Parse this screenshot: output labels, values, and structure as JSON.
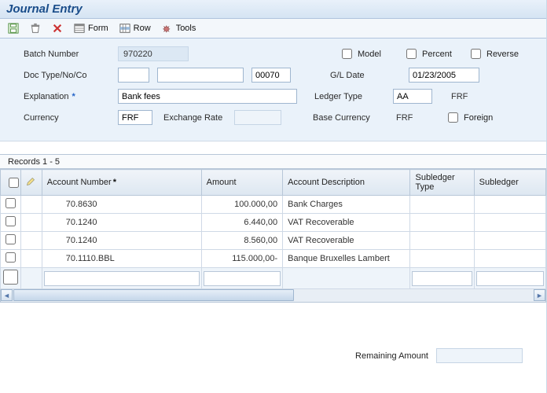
{
  "title": "Journal Entry",
  "toolbar": {
    "form": "Form",
    "row": "Row",
    "tools": "Tools"
  },
  "header": {
    "batch_number_label": "Batch Number",
    "batch_number": "970220",
    "model_label": "Model",
    "percent_label": "Percent",
    "reverse_label": "Reverse",
    "doc_label": "Doc Type/No/Co",
    "doc_type": "",
    "doc_no": "",
    "doc_co": "00070",
    "gl_date_label": "G/L Date",
    "gl_date": "01/23/2005",
    "explanation_label": "Explanation",
    "explanation": "Bank fees",
    "ledger_type_label": "Ledger Type",
    "ledger_type": "AA",
    "ledger_type_disp": "FRF",
    "currency_label": "Currency",
    "currency": "FRF",
    "exchange_rate_label": "Exchange Rate",
    "exchange_rate": "",
    "base_currency_label": "Base Currency",
    "base_currency": "FRF",
    "foreign_label": "Foreign"
  },
  "grid": {
    "records_label": "Records 1 - 5",
    "columns": {
      "account_number": "Account Number",
      "amount": "Amount",
      "account_description": "Account\nDescription",
      "subledger_type": "Subledger\nType",
      "subledger": "Subledger"
    },
    "rows": [
      {
        "account": "70.8630",
        "amount": "100.000,00",
        "desc": "Bank Charges",
        "sub_type": "",
        "sub": ""
      },
      {
        "account": "70.1240",
        "amount": "6.440,00",
        "desc": "VAT Recoverable",
        "sub_type": "",
        "sub": ""
      },
      {
        "account": "70.1240",
        "amount": "8.560,00",
        "desc": "VAT Recoverable",
        "sub_type": "",
        "sub": ""
      },
      {
        "account": "70.1110.BBL",
        "amount": "115.000,00-",
        "desc": "Banque Bruxelles Lambert",
        "sub_type": "",
        "sub": ""
      }
    ]
  },
  "footer": {
    "remaining_label": "Remaining Amount",
    "remaining_value": ""
  }
}
